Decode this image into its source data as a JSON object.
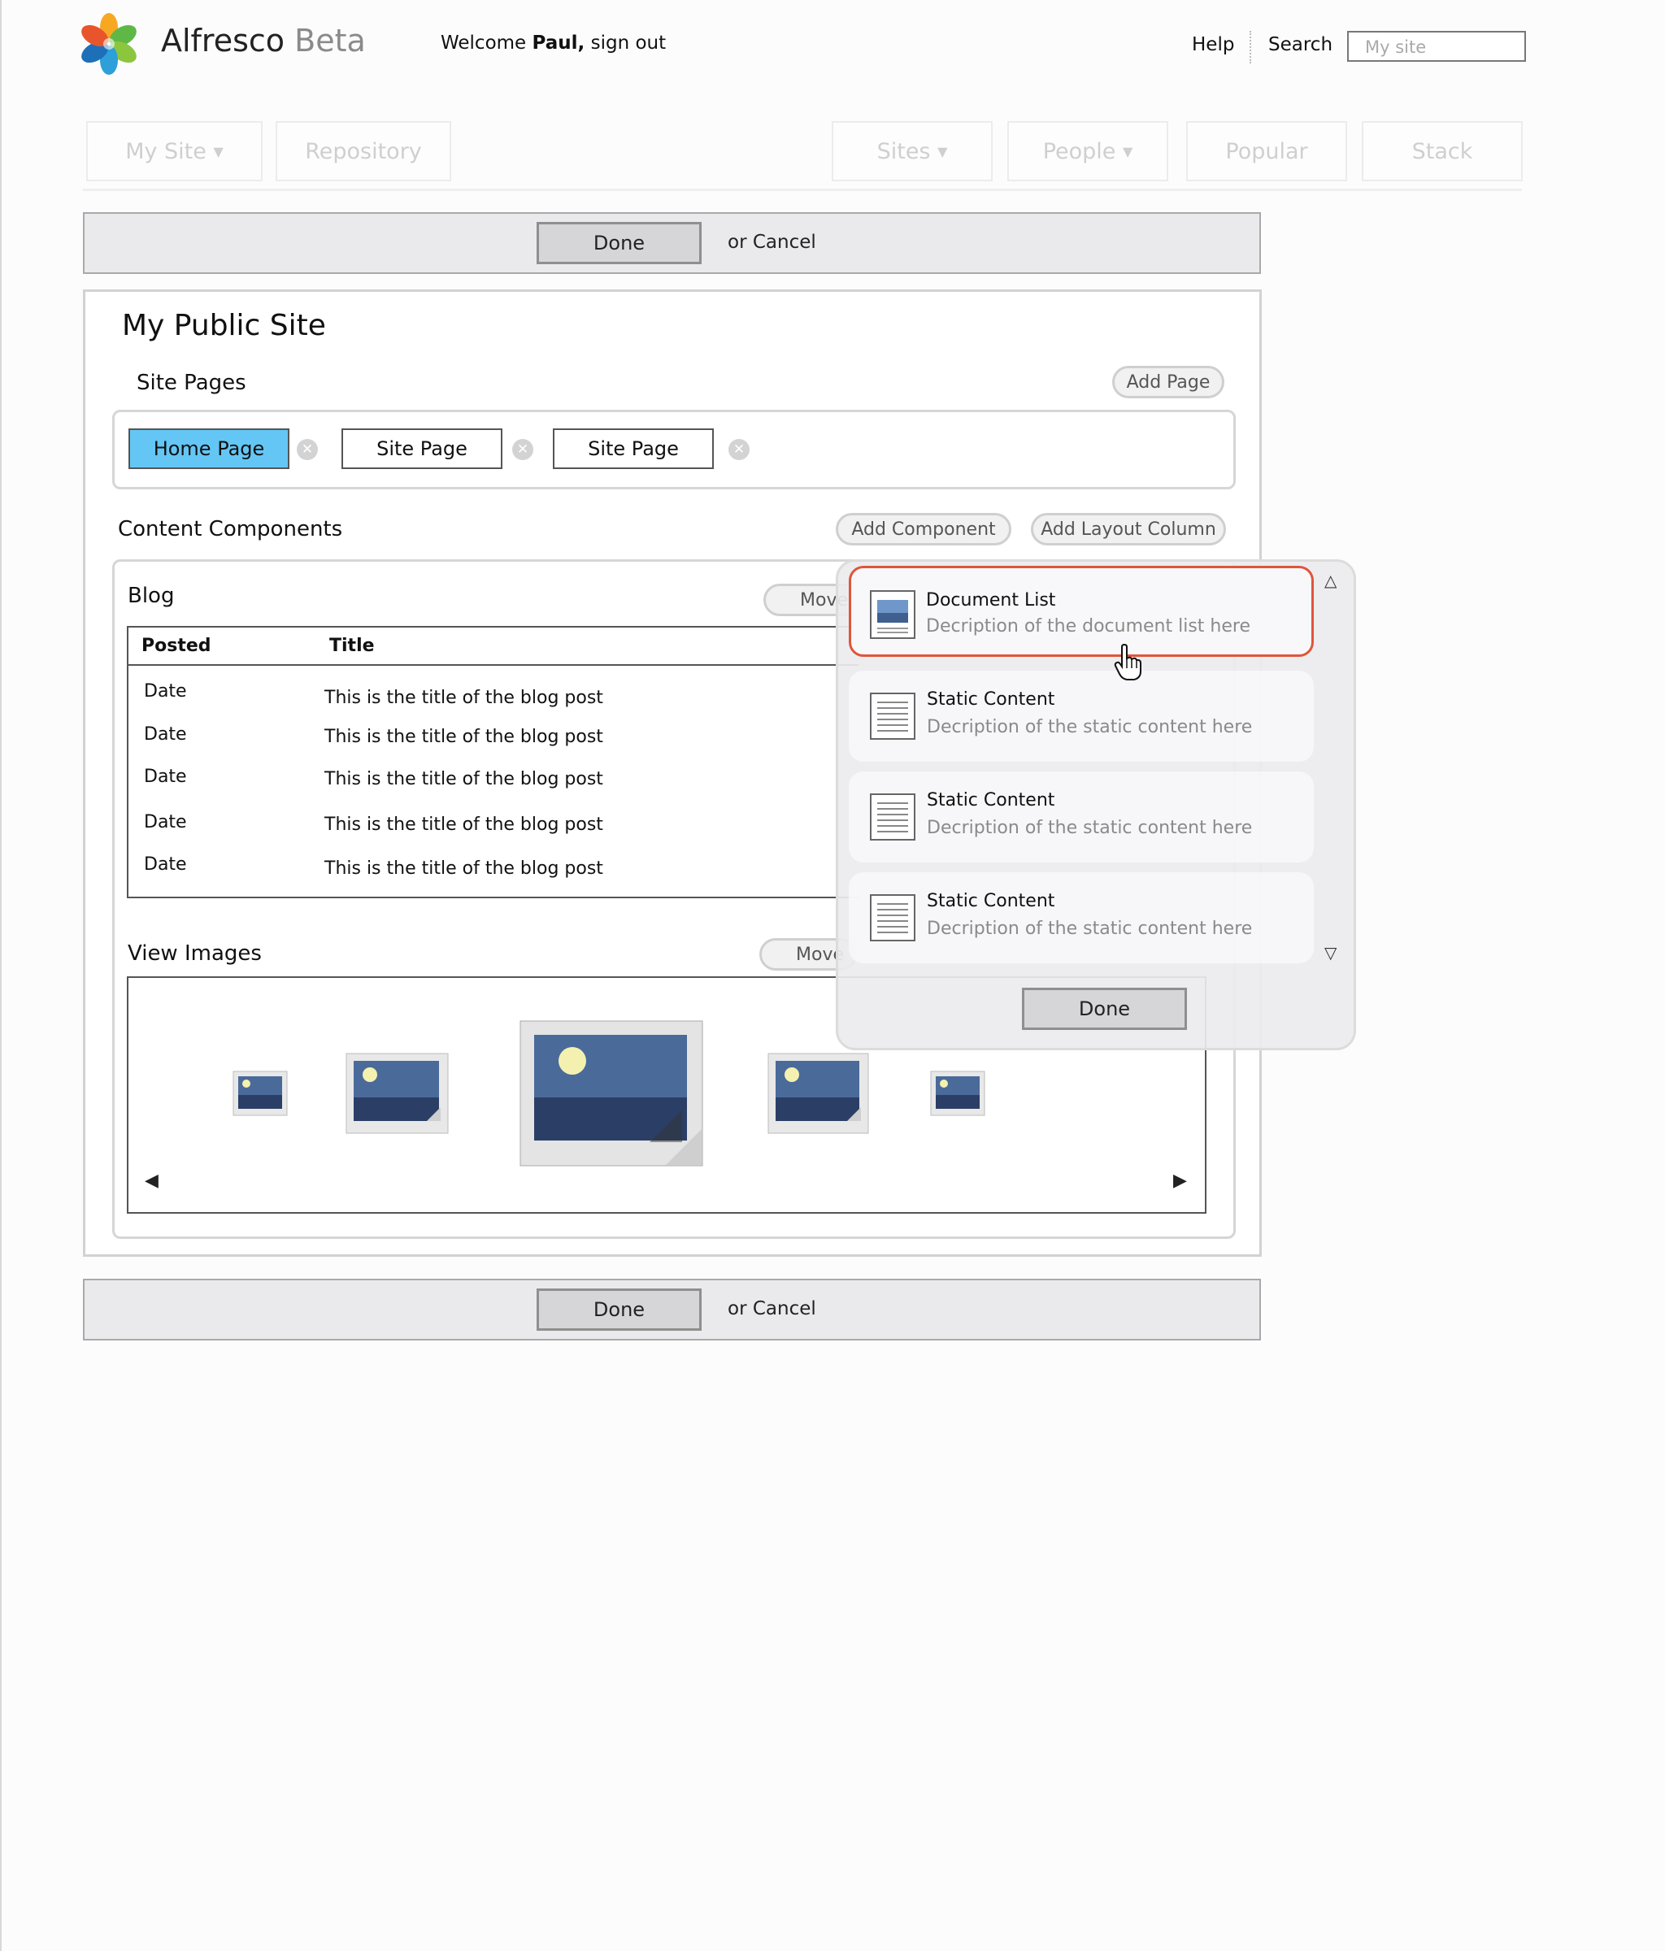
{
  "header": {
    "brand_name": "Alfresco",
    "brand_suffix": "Beta",
    "welcome_prefix": "Welcome",
    "user_name": "Paul,",
    "sign_out": "sign out",
    "help": "Help",
    "search": "Search",
    "search_placeholder": "My site"
  },
  "nav": {
    "items": [
      {
        "label": "My Site",
        "has_menu": true
      },
      {
        "label": "Repository",
        "has_menu": false
      },
      {
        "label": "Sites",
        "has_menu": true
      },
      {
        "label": "People",
        "has_menu": true
      },
      {
        "label": "Popular",
        "has_menu": false
      },
      {
        "label": "Stack",
        "has_menu": false
      }
    ],
    "menu_indicator": "▼"
  },
  "actions": {
    "done": "Done",
    "or_cancel": "or Cancel"
  },
  "site": {
    "title": "My Public Site",
    "pages_label": "Site Pages",
    "add_page": "Add Page",
    "pages": [
      "Home Page",
      "Site Page",
      "Site Page"
    ],
    "active_page": "Home Page"
  },
  "components": {
    "label": "Content Components",
    "add_component": "Add Component",
    "add_layout_column": "Add Layout Column",
    "move": "Move"
  },
  "blog": {
    "title": "Blog",
    "columns": [
      "Posted",
      "Title"
    ],
    "rows": [
      {
        "posted": "Date",
        "title": "This is the title of the blog post"
      },
      {
        "posted": "Date",
        "title": "This is the title of the blog post"
      },
      {
        "posted": "Date",
        "title": "This is the title of the blog post"
      },
      {
        "posted": "Date",
        "title": "This is the title of the blog post"
      },
      {
        "posted": "Date",
        "title": "This is the title of the blog post"
      }
    ]
  },
  "images": {
    "title": "View Images",
    "prev_icon": "◀",
    "next_icon": "▶"
  },
  "popup": {
    "items": [
      {
        "name": "Document List",
        "desc": "Decription of the document list here",
        "icon": "document-list-icon"
      },
      {
        "name": "Static Content",
        "desc": "Decription of the static content here",
        "icon": "static-content-icon"
      },
      {
        "name": "Static Content",
        "desc": "Decription of the static content here",
        "icon": "static-content-icon"
      },
      {
        "name": "Static Content",
        "desc": "Decription of the static content here",
        "icon": "static-content-icon"
      }
    ],
    "done": "Done",
    "scroll_up": "△",
    "scroll_down": "▽"
  },
  "colors": {
    "active_tab": "#64c6f5",
    "selected_border": "#e0553b"
  }
}
